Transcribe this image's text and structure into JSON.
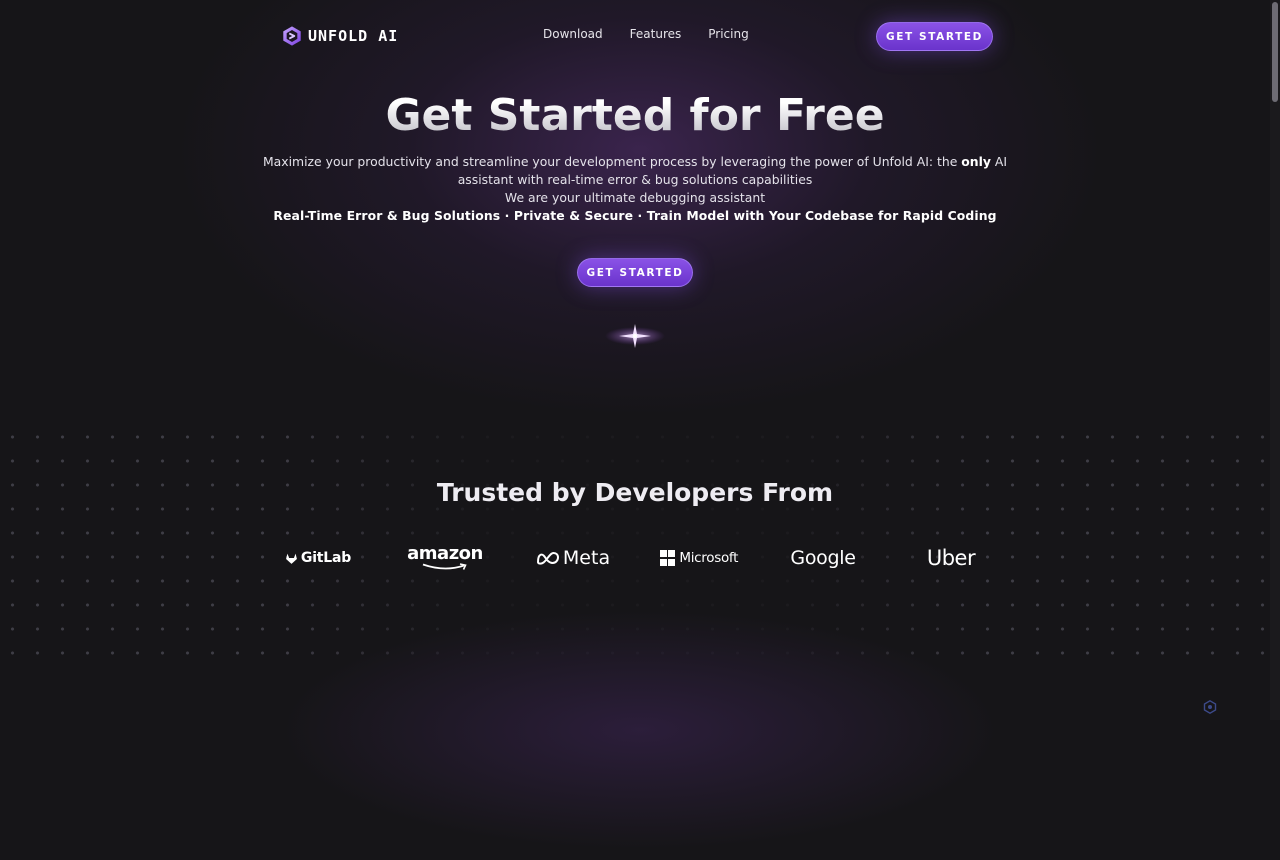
{
  "brand": {
    "name": "UNFOLD AI",
    "logo_icon": "hexagon-chevron-icon"
  },
  "nav": {
    "links": [
      {
        "label": "Download"
      },
      {
        "label": "Features"
      },
      {
        "label": "Pricing"
      }
    ],
    "cta_label": "GET STARTED"
  },
  "hero": {
    "title": "Get Started for Free",
    "description_pre": "Maximize your productivity and streamline your development process by leveraging the power of Unfold AI: the ",
    "description_bold": "only",
    "description_post": " AI assistant with real-time error & bug solutions capabilities",
    "subtitle": "We are your ultimate debugging assistant",
    "features_line": "Real-Time Error & Bug Solutions · Private & Secure · Train Model with Your Codebase for Rapid Coding",
    "cta_label": "GET STARTED",
    "sparkle_icon": "sparkle-star-icon"
  },
  "trusted": {
    "title": "Trusted by Developers From",
    "logos": [
      {
        "name": "GitLab",
        "icon": "gitlab-fox-icon"
      },
      {
        "name": "amazon",
        "icon": "amazon-smile-icon"
      },
      {
        "name": "Meta",
        "icon": "meta-infinity-icon"
      },
      {
        "name": "Microsoft",
        "icon": "microsoft-grid-icon"
      },
      {
        "name": "Google"
      },
      {
        "name": "Uber"
      }
    ]
  },
  "colors": {
    "background": "#161518",
    "accent": "#7b44dd",
    "accent_light": "#b99cff",
    "text": "#e8e6ee"
  }
}
